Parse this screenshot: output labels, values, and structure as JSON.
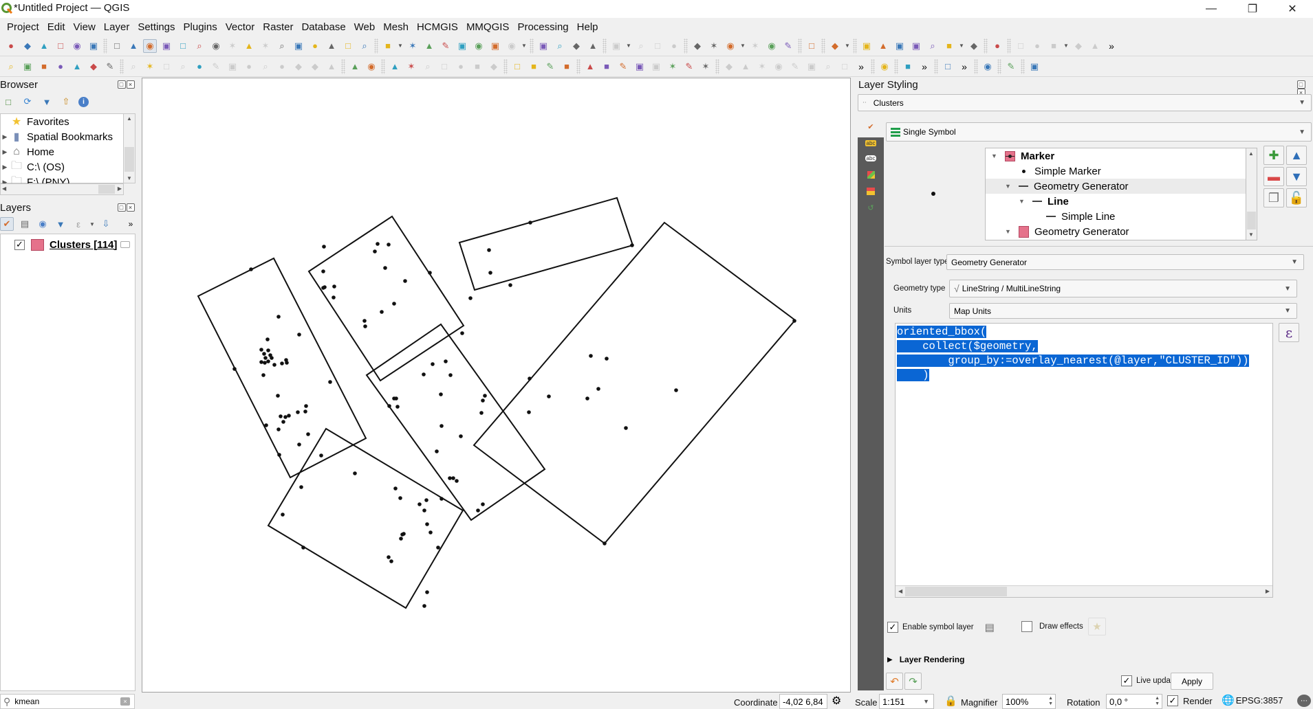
{
  "window": {
    "title": "*Untitled Project — QGIS",
    "controls": [
      "minimize",
      "restore",
      "close"
    ]
  },
  "menubar": [
    {
      "label": "Project",
      "u": "j"
    },
    {
      "label": "Edit",
      "u": "E"
    },
    {
      "label": "View",
      "u": "V"
    },
    {
      "label": "Layer",
      "u": "L"
    },
    {
      "label": "Settings",
      "u": "S"
    },
    {
      "label": "Plugins",
      "u": "P"
    },
    {
      "label": "Vector",
      "u": "o"
    },
    {
      "label": "Raster",
      "u": "R"
    },
    {
      "label": "Database",
      "u": "D"
    },
    {
      "label": "Web",
      "u": "W"
    },
    {
      "label": "Mesh",
      "u": "M"
    },
    {
      "label": "HCMGIS",
      "u": ""
    },
    {
      "label": "MMQGIS",
      "u": ""
    },
    {
      "label": "Processing",
      "u": "r"
    },
    {
      "label": "Help",
      "u": "H"
    }
  ],
  "toolbar1": [
    "new-project",
    "open-project",
    "save-project",
    "save-as",
    "print-layout",
    "style-manager",
    "|",
    "pan",
    "pan-to-selection",
    "zoom-in",
    "zoom-out",
    "zoom-full",
    "zoom-to-selection",
    "zoom-to-layer",
    "zoom-native",
    "zoom-last",
    "zoom-next",
    "new-map-view",
    "new-3d-map",
    "new-bookmark",
    "show-bookmarks",
    "temporal-controller",
    "refresh",
    "|",
    "identify",
    "open-attribute-table",
    "processing-toolbox",
    "statistics",
    "attribute-table-menu",
    "measure",
    "map-tips",
    "select-location",
    "|",
    "select-features",
    "select-by-value",
    "deselect",
    "select-by-location",
    "|",
    "digitize-1",
    "digitize-2",
    "digitize-3",
    "digitize-4",
    "|",
    "label-tool",
    "select-tool",
    "vertex-tool",
    "node-tool",
    "star-tool",
    "text-tool",
    "|",
    "annotation",
    "|",
    "gear-plugin",
    "|",
    "shape-digitize",
    "line-tool",
    "polygon-tool",
    "circle-tool",
    "bezier-tool",
    "freehand-tool",
    "settings-gear",
    "|",
    "plot-tool",
    "|",
    "grey-1",
    "grey-2",
    "grey-3",
    "grey-4",
    "grey-5",
    "more"
  ],
  "toolbar2": [
    "add-layer",
    "add-wms",
    "add-vector",
    "add-line",
    "add-raster",
    "add-mesh",
    "add-virtual",
    "|",
    "toggle-edit",
    "pencil",
    "save-edits",
    "digitize",
    "add-point",
    "move",
    "node",
    "delete",
    "cut",
    "copy",
    "paste",
    "undo",
    "redo",
    "|",
    "label-yellow",
    "layer-diagram",
    "|",
    "label-pin",
    "label-red",
    "grey-label-1",
    "grey-label-2",
    "grey-label-3",
    "grey-label-4",
    "grey-label-5",
    "|",
    "hexagon",
    "globe-dl",
    "globe-search",
    "globe-binoculars",
    "|",
    "python",
    "ede",
    "scatter",
    "cluster",
    "grey-x",
    "green-sphere",
    "ref",
    "binoculars",
    "|",
    "grey-a",
    "grey-b",
    "grey-c",
    "grey-d",
    "grey-e",
    "grey-f",
    "grey-g",
    "grey-h",
    "more",
    "|",
    "help-book",
    "|",
    "refresh-table",
    "more",
    "|",
    "red-tool",
    "more",
    "|",
    "orange-tool",
    "|",
    "green-tool",
    "|",
    "clipboard"
  ],
  "browser": {
    "title": "Browser",
    "items": [
      {
        "label": "Favorites",
        "icon": "star-icon",
        "expandable": false
      },
      {
        "label": "Spatial Bookmarks",
        "icon": "bookmark-icon",
        "expandable": true
      },
      {
        "label": "Home",
        "icon": "home-icon",
        "expandable": true
      },
      {
        "label": "C:\\ (OS)",
        "icon": "folder-icon",
        "expandable": true
      },
      {
        "label": "F:\\ (PNY)",
        "icon": "folder-icon",
        "expandable": true
      }
    ]
  },
  "layers": {
    "title": "Layers",
    "items": [
      {
        "label": "Clusters [114]",
        "checked": true,
        "color": "#e5728b"
      }
    ]
  },
  "layer_styling": {
    "title": "Layer Styling",
    "layer": "Clusters",
    "renderer": "Single Symbol",
    "symbol_tree": [
      {
        "label": "Marker",
        "level": 0,
        "bold": true,
        "icon": "marker-swatch",
        "expanded": true
      },
      {
        "label": "Simple Marker",
        "level": 1,
        "bold": false,
        "icon": "dot",
        "expanded": null
      },
      {
        "label": "Geometry Generator",
        "level": 1,
        "bold": false,
        "icon": "line",
        "expanded": true,
        "selected": true
      },
      {
        "label": "Line",
        "level": 2,
        "bold": true,
        "icon": "line",
        "expanded": true
      },
      {
        "label": "Simple Line",
        "level": 3,
        "bold": false,
        "icon": "line",
        "expanded": null
      },
      {
        "label": "Geometry Generator",
        "level": 1,
        "bold": false,
        "icon": "fill-swatch",
        "expanded": true
      }
    ],
    "symbol_layer_type_label": "Symbol layer type",
    "symbol_layer_type": "Geometry Generator",
    "geometry_type_label": "Geometry type",
    "geometry_type": "LineString / MultiLineString",
    "units_label": "Units",
    "units": "Map Units",
    "expression_lines": [
      "oriented_bbox(",
      "    collect($geometry,",
      "        group_by:=overlay_nearest(@layer,\"CLUSTER_ID\"))",
      "    )"
    ],
    "enable_symbol_layer_label": "Enable symbol layer",
    "enable_symbol_layer": true,
    "draw_effects_label": "Draw effects",
    "draw_effects": false,
    "layer_rendering_label": "Layer Rendering",
    "live_update_label": "Live update",
    "live_update": true,
    "apply_label": "Apply"
  },
  "statusbar": {
    "search_value": "kmean",
    "coordinate_label": "Coordinate",
    "coordinate": "-4,02 6,84",
    "scale_label": "Scale",
    "scale": "1:151",
    "magnifier_label": "Magnifier",
    "magnifier": "100%",
    "rotation_label": "Rotation",
    "rotation": "0,0 °",
    "render_label": "Render",
    "render": true,
    "crs": "EPSG:3857"
  },
  "map": {
    "stroke_color": "#111111",
    "point_color": "#111111",
    "cluster_count": 6,
    "feature_count": 114
  }
}
